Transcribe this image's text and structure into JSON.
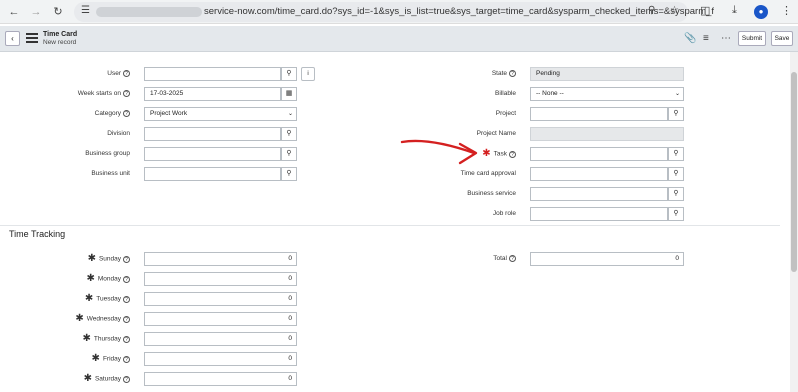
{
  "browser": {
    "url": "service-now.com/time_card.do?sys_id=-1&sys_is_list=true&sys_target=time_card&sysparm_checked_items=&sysparm_fixed_query...",
    "icons": [
      "back-arrow-icon",
      "forward-arrow-icon",
      "reload-icon",
      "tune-icon",
      "zoom-icon",
      "star-icon",
      "extensions-icon",
      "download-icon",
      "profile-icon",
      "menu-icon"
    ]
  },
  "header": {
    "title": "Time Card",
    "subtitle": "New record",
    "submit_label": "Submit",
    "save_label": "Save"
  },
  "form": {
    "user": {
      "label": "User",
      "value": ""
    },
    "week_starts_on": {
      "label": "Week starts on",
      "value": "17-03-2025"
    },
    "category": {
      "label": "Category",
      "value": "Project Work"
    },
    "division": {
      "label": "Division",
      "value": ""
    },
    "business_group": {
      "label": "Business group",
      "value": ""
    },
    "business_unit": {
      "label": "Business unit",
      "value": ""
    },
    "state": {
      "label": "State",
      "value": "Pending"
    },
    "billable": {
      "label": "Billable",
      "value": "-- None --"
    },
    "project": {
      "label": "Project",
      "value": ""
    },
    "project_name": {
      "label": "Project Name",
      "value": ""
    },
    "task": {
      "label": "Task",
      "value": ""
    },
    "time_card_approval": {
      "label": "Time card approval",
      "value": ""
    },
    "business_service": {
      "label": "Business service",
      "value": ""
    },
    "job_role": {
      "label": "Job role",
      "value": ""
    }
  },
  "time_tracking": {
    "title": "Time Tracking",
    "days": [
      {
        "label": "Sunday",
        "value": "0"
      },
      {
        "label": "Monday",
        "value": "0"
      },
      {
        "label": "Tuesday",
        "value": "0"
      },
      {
        "label": "Wednesday",
        "value": "0"
      },
      {
        "label": "Thursday",
        "value": "0"
      },
      {
        "label": "Friday",
        "value": "0"
      },
      {
        "label": "Saturday",
        "value": "0"
      }
    ],
    "total": {
      "label": "Total",
      "value": "0"
    }
  },
  "colors": {
    "annotation_arrow": "#d42020",
    "header_bg": "#e4e8ec",
    "readonly_bg": "#e6e8ea"
  }
}
